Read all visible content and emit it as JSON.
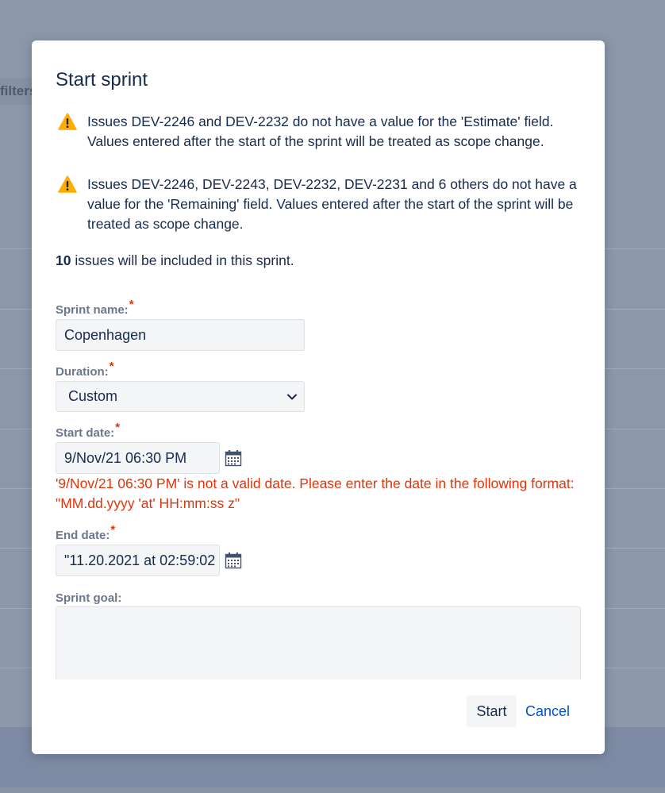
{
  "background": {
    "filter_chip_label": "filters"
  },
  "dialog": {
    "title": "Start sprint",
    "warnings": [
      "Issues DEV-2246 and DEV-2232 do not have a value for the 'Estimate' field. Values entered after the start of the sprint will be treated as scope change.",
      "Issues DEV-2246, DEV-2243, DEV-2232, DEV-2231 and 6 others do not have a value for the 'Remaining' field. Values entered after the start of the sprint will be treated as scope change."
    ],
    "issue_count": "10",
    "issue_count_suffix": " issues will be included in this sprint.",
    "required_marker": "*",
    "sprint_name": {
      "label": "Sprint name:",
      "value": "Copenhagen"
    },
    "duration": {
      "label": "Duration:",
      "value": "Custom"
    },
    "start_date": {
      "label": "Start date:",
      "value": "9/Nov/21 06:30 PM",
      "error": "'9/Nov/21 06:30 PM' is not a valid date. Please enter the date in the following format: \"MM.dd.yyyy 'at' HH:mm:ss z\""
    },
    "end_date": {
      "label": "End date:",
      "value": "\"11.20.2021 at 02:59:02"
    },
    "sprint_goal": {
      "label": "Sprint goal:",
      "value": ""
    },
    "buttons": {
      "start": "Start",
      "cancel": "Cancel"
    }
  },
  "colors": {
    "warning": "#ffab00",
    "error": "#de350b",
    "link": "#0052cc",
    "text": "#172b4d",
    "label": "#6b778c"
  }
}
